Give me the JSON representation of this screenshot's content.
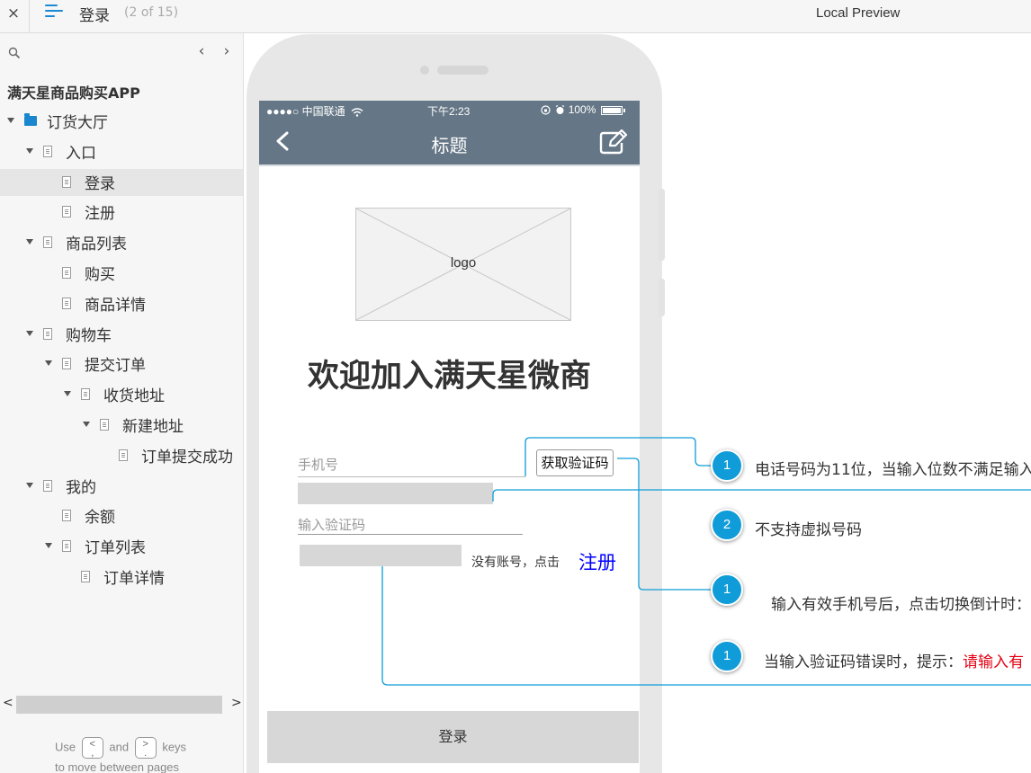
{
  "topbar": {
    "close_icon": "×",
    "page_title": "登录",
    "page_count": "(2 of 15)",
    "preview_label": "Local Preview"
  },
  "sidebar": {
    "prev_glyph": "‹",
    "next_glyph": "›",
    "project_name": "满天星商品购买APP",
    "tree": [
      {
        "label": "订货大厅",
        "type": "folder",
        "expanded": true
      },
      {
        "label": "入口",
        "type": "page",
        "expanded": true
      },
      {
        "label": "登录",
        "type": "page",
        "selected": true
      },
      {
        "label": "注册",
        "type": "page"
      },
      {
        "label": "商品列表",
        "type": "page",
        "expanded": true
      },
      {
        "label": "购买",
        "type": "page"
      },
      {
        "label": "商品详情",
        "type": "page"
      },
      {
        "label": "购物车",
        "type": "page",
        "expanded": true
      },
      {
        "label": "提交订单",
        "type": "page",
        "expanded": true
      },
      {
        "label": "收货地址",
        "type": "page",
        "expanded": true
      },
      {
        "label": "新建地址",
        "type": "page",
        "expanded": true
      },
      {
        "label": "订单提交成功",
        "type": "page"
      },
      {
        "label": "我的",
        "type": "page",
        "expanded": true
      },
      {
        "label": "余额",
        "type": "page"
      },
      {
        "label": "订单列表",
        "type": "page",
        "expanded": true
      },
      {
        "label": "订单详情",
        "type": "page"
      }
    ],
    "hint": {
      "use": "Use",
      "key_prev": "<",
      "key_prev_sub": ",",
      "and": "and",
      "key_next": ">",
      "key_next_sub": ".",
      "keys": "keys",
      "line2": "to move between pages"
    }
  },
  "phone": {
    "status": {
      "carrier": "●●●●○ 中国联通",
      "time": "下午2:23",
      "battery": "100%"
    },
    "nav_title": "标题",
    "logo_label": "logo",
    "welcome": "欢迎加入满天星微商",
    "phone_placeholder": "手机号",
    "get_code": "获取验证码",
    "code_placeholder": "输入验证码",
    "no_account": "没有账号，点击",
    "register": "注册",
    "login": "登录"
  },
  "annotations": [
    {
      "num": "1",
      "text": "电话号码为11位，当输入位数不满足输入"
    },
    {
      "num": "2",
      "text": "不支持虚拟号码"
    },
    {
      "num": "1",
      "text": "输入有效手机号后，点击切换倒计时："
    },
    {
      "num": "1",
      "text": "当输入验证码错误时，提示：",
      "red": "请输入有"
    }
  ],
  "colors": {
    "nav_bg": "#657786",
    "accent": "#0f9cd8",
    "link": "#0000ff",
    "error": "#e60012",
    "folder": "#1a86cf"
  }
}
